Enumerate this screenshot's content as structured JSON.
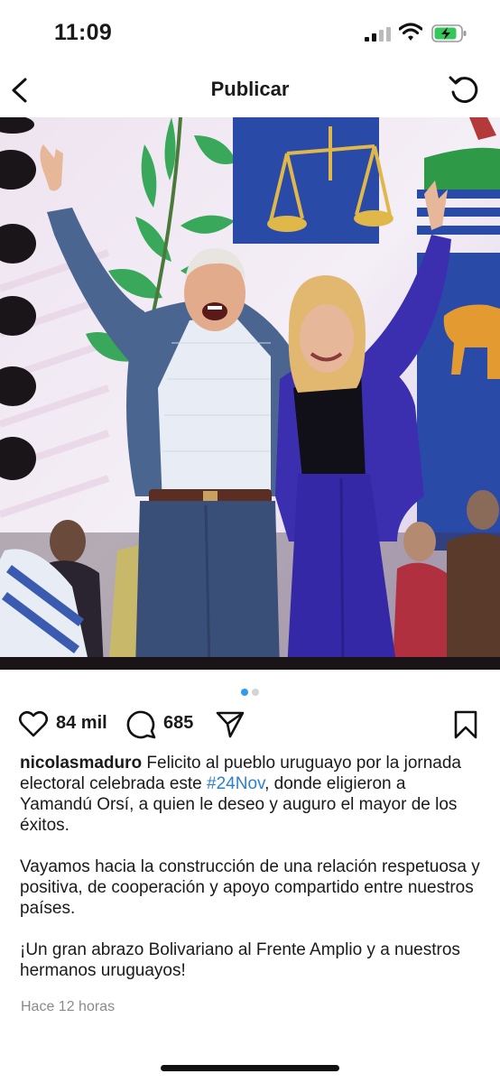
{
  "status_bar": {
    "time": "11:09"
  },
  "header": {
    "title": "Publicar"
  },
  "carousel": {
    "count": 2,
    "active_index": 0
  },
  "actions": {
    "like_count": "84 mil",
    "comment_count": "685"
  },
  "post": {
    "username": "nicolasmaduro",
    "caption_part1": " Felicito al pueblo uruguayo por la jornada electoral celebrada este ",
    "hashtag": "#24Nov",
    "caption_part2": ", donde eligieron a Yamandú Orsí, a quien le deseo y auguro el mayor de los éxitos.",
    "paragraph2": "Vayamos hacia la construcción de una relación respetuosa y positiva, de cooperación y apoyo compartido entre nuestros países.",
    "paragraph3": "¡Un gran abrazo Bolivariano al Frente Amplio y a nuestros hermanos uruguayos!",
    "timestamp": "Hace 12 horas"
  },
  "colors": {
    "hashtag": "#2e7fd0",
    "dot_active": "#2f9bf0",
    "suit_blue": "#4a6590",
    "purple_outfit": "#3b2fb0"
  },
  "icons": [
    "back-icon",
    "refresh-icon",
    "heart-icon",
    "comment-icon",
    "share-icon",
    "bookmark-icon",
    "signal-icon",
    "wifi-icon",
    "battery-icon"
  ]
}
